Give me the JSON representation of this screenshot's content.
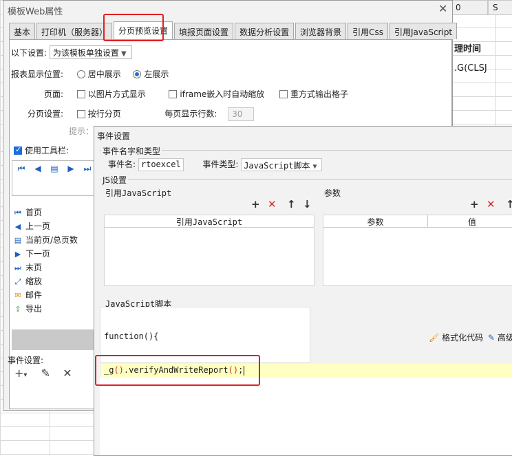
{
  "sheet": {
    "cells": [
      {
        "id": "c0",
        "text": "0"
      },
      {
        "id": "cs",
        "text": "S"
      },
      {
        "id": "header",
        "text": "理时间"
      },
      {
        "id": "val",
        "text": ".G(CLSJ"
      }
    ]
  },
  "main_window": {
    "title": "模板Web属性",
    "close": "✕",
    "tabs": [
      "基本",
      "打印机（服务器）",
      "分页预览设置",
      "填报页面设置",
      "数据分析设置",
      "浏览器背景",
      "引用Css",
      "引用JavaScript"
    ],
    "active_tab": "分页预览设置",
    "settings_label": "以下设置:",
    "settings_select": "为该模板单独设置",
    "display_position_label": "报表显示位置:",
    "position_center": "居中展示",
    "position_left": "左展示",
    "page_label": "页面:",
    "opt_image": "以图片方式显示",
    "opt_iframe": "iframe嵌入时自动缩放",
    "opt_repeat": "重方式输出格子",
    "paging_label": "分页设置:",
    "opt_row_paging": "按行分页",
    "rows_per_page_label": "每页显示行数:",
    "rows_per_page_value": "30",
    "hint": "提示：设",
    "use_toolbar": "使用工具栏:",
    "toolbar_items": [
      "首页",
      "上一页",
      "当前页/总页数",
      "下一页",
      "末页",
      "缩放",
      "邮件",
      "导出"
    ],
    "event_settings": "事件设置:"
  },
  "event_dialog": {
    "title": "事件设置",
    "group_name_type": "事件名字和类型",
    "event_name_label": "事件名:",
    "event_name_value": "rtoexcel",
    "event_type_label": "事件类型:",
    "event_type_value": "JavaScript脚本",
    "group_js": "JS设置",
    "ref_js_label": "引用JavaScript",
    "params_label": "参数",
    "ref_grid_header": "引用JavaScript",
    "param_col": "参数",
    "value_col": "值",
    "script_label": "JavaScript脚本",
    "function_text": "function(){",
    "format_code": "格式化代码",
    "advanced": "高级",
    "code_prefix": "_g",
    "code_mid": ".verifyAndWriteReport",
    "code_suffix": ";"
  },
  "colors": {
    "highlight": "#e02020",
    "accent": "#1d6fd8",
    "code_line_bg": "#ffffc2"
  }
}
